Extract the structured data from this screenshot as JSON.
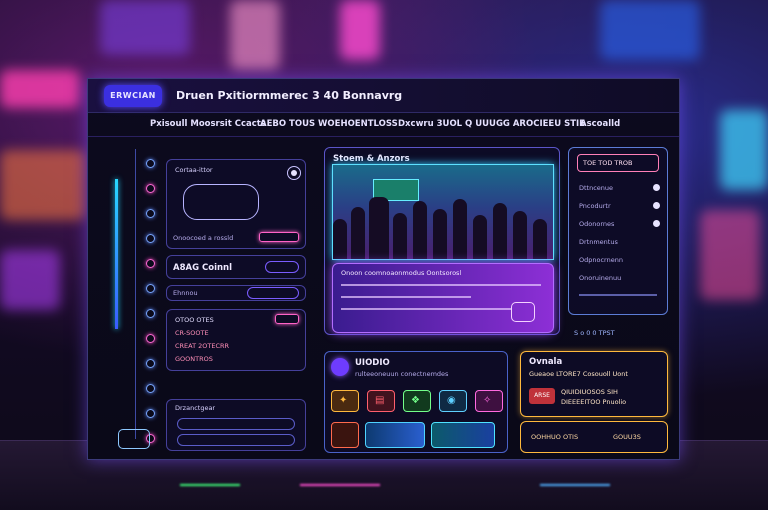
{
  "window": {
    "logo_text": "ERWCIAN",
    "title": "Druen Pxitiormmerec 3 40 Bonnavrg"
  },
  "nav": [
    "Pxisoull Moosrsit Ccacts",
    "AEBO TOUS WOEHOENTLOSS",
    "Dxcwru 3UOL Q UUUGG AROCIEEU STIE",
    "Ascoalld"
  ],
  "left_panel": {
    "header": "Cortaa-ittor",
    "footer_label": "Onoocoed a rossld",
    "section_title": "A8AG Coinnl",
    "row_label": "Ehnnou",
    "list_items": [
      "OTOO OTES",
      "CR-SOOTE",
      "CREAT 2OTECRR",
      "GOONTROS"
    ],
    "bottom_label": "Drzanctgear"
  },
  "center_panel": {
    "title": "Stoem & Anzors",
    "caption": "Onoon coomnoaonmodus    Oontsorosl"
  },
  "right_panel": {
    "header": "TOE TOD TROB",
    "items": [
      "Dttncenue",
      "Pncodurtr",
      "Odonornes",
      "Drtnmentus",
      "Odpnocrnenn",
      "Onoruinenuu"
    ],
    "footer": "S o 0 0 TPST"
  },
  "bottom_center": {
    "title": "UIODIO",
    "subtitle": "rulteeoneuun conectnemdes",
    "tiles": [
      {
        "icon": "flame-icon",
        "glyph": "✦",
        "color": "#ffb93d"
      },
      {
        "icon": "chat-icon",
        "glyph": "▤",
        "color": "#ff5f6d"
      },
      {
        "icon": "leaf-icon",
        "glyph": "❖",
        "color": "#73ff8a"
      },
      {
        "icon": "eye-icon",
        "glyph": "◉",
        "color": "#5fd0ff"
      },
      {
        "icon": "star-icon",
        "glyph": "✧",
        "color": "#ff6ae0"
      }
    ]
  },
  "bottom_right": {
    "title": "Ovnala",
    "line1": "Gueaoe LTORE7 Cosouoll Uont",
    "line2": "QIUIDIUOSOS SIH",
    "line3": "DIEEEEITOO Pnuolio",
    "badge": "ARSE",
    "foot_left": "OOHHUO OTIS",
    "foot_right": "GOUU3S"
  },
  "colors": {
    "accent": "#7a5cff",
    "pink": "#ff63c8",
    "cyan": "#33caff",
    "gold": "#ffb93d"
  }
}
